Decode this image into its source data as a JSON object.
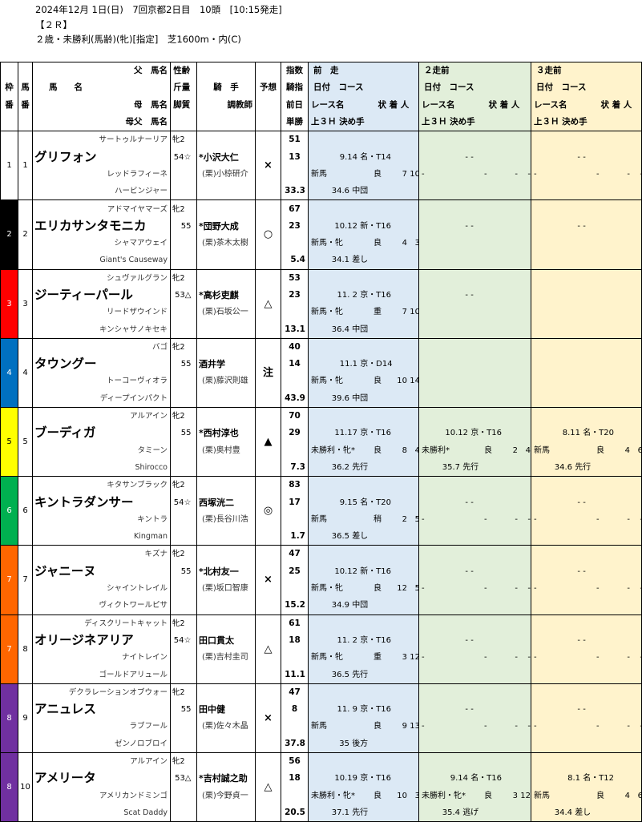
{
  "race": {
    "line1": "2024年12月 1日(日)　7回京都2日目　10頭　[10:15発走]",
    "line2": "【２Ｒ】",
    "line3": "２歳・未勝利(馬齢)(牝)[指定]　芝1600m・内(C)"
  },
  "headers": {
    "waku": [
      "枠",
      "番"
    ],
    "uma": [
      "馬",
      "番"
    ],
    "name": [
      "父　馬名",
      "馬　　名",
      "母　馬名",
      "母父　馬名"
    ],
    "sex": [
      "性齢",
      "斤量",
      "脚質"
    ],
    "jockey": [
      "騎　手",
      "調教師"
    ],
    "pred": "予想",
    "idx": [
      "指数",
      "騎指",
      "前日",
      "単勝"
    ],
    "prev1": [
      "前　走",
      "日付　コース",
      "レース名　　　　状 着 人",
      "上３Ｈ 決め手"
    ],
    "prev2": [
      "２走前",
      "日付　コース",
      "レース名　　　　状 着 人",
      "上３Ｈ 決め手"
    ],
    "prev3": [
      "３走前",
      "日付　コース",
      "レース名　　　　状 着 人",
      "上３Ｈ 決め手"
    ]
  },
  "horses": [
    {
      "waku": "1",
      "num": "1",
      "sire": "サートゥルナーリア",
      "name": "グリフォン",
      "dam": "レッドラフィーネ",
      "damsire": "ハービンジャー",
      "sex": "牝2",
      "weight": "54☆",
      "jockey": "*小沢大仁",
      "trainer": "(栗)小椋研介",
      "pred": "×",
      "idx": "51",
      "jidx": "13",
      "odds": "33.3",
      "p1": {
        "date": "9.14",
        "course": "名・T14",
        "race": "新馬",
        "cond": "良",
        "pos": "7",
        "pop": "10",
        "l3": "34.6",
        "style": "中団"
      },
      "p2": {
        "date": "-",
        "course": "-",
        "race": "-",
        "cond": "-",
        "pos": "-",
        "pop": "-",
        "l3": "",
        "style": ""
      },
      "p3": {
        "date": "-",
        "course": "-",
        "race": "-",
        "cond": "-",
        "pos": "-",
        "pop": "-",
        "l3": "",
        "style": ""
      }
    },
    {
      "waku": "2",
      "num": "2",
      "sire": "アドマイヤマーズ",
      "name": "エリカサンタモニカ",
      "dam": "シャマアウェイ",
      "damsire": "Giant's Causeway",
      "sex": "牝2",
      "weight": "55",
      "jockey": "*団野大成",
      "trainer": "(栗)茶木太樹",
      "pred": "○",
      "idx": "67",
      "jidx": "23",
      "odds": "5.4",
      "p1": {
        "date": "10.12",
        "course": "新・T16",
        "race": "新馬・牝",
        "cond": "良",
        "pos": "4",
        "pop": "3",
        "l3": "34.1",
        "style": "差し"
      },
      "p2": {
        "date": "-",
        "course": "-",
        "race": "",
        "cond": "",
        "pos": "",
        "pop": "",
        "l3": "",
        "style": ""
      },
      "p3": {
        "date": "-",
        "course": "-",
        "race": "",
        "cond": "",
        "pos": "",
        "pop": "",
        "l3": "",
        "style": ""
      }
    },
    {
      "waku": "3",
      "num": "3",
      "sire": "シュヴァルグラン",
      "name": "ジーティーパール",
      "dam": "リードザウインド",
      "damsire": "キンシャサノキセキ",
      "sex": "牝2",
      "weight": "53△",
      "jockey": "*高杉吏麒",
      "trainer": "(栗)石坂公一",
      "pred": "△",
      "idx": "53",
      "jidx": "23",
      "odds": "13.1",
      "p1": {
        "date": "11. 2",
        "course": "京・T16",
        "race": "新馬・牝",
        "cond": "重",
        "pos": "7",
        "pop": "10",
        "l3": "36.4",
        "style": "中団"
      },
      "p2": {
        "date": "-",
        "course": "-",
        "race": "",
        "cond": "",
        "pos": "",
        "pop": "",
        "l3": "",
        "style": ""
      },
      "p3": {
        "date": "",
        "course": "",
        "race": "",
        "cond": "",
        "pos": "",
        "pop": "",
        "l3": "",
        "style": ""
      }
    },
    {
      "waku": "4",
      "num": "4",
      "sire": "バゴ",
      "name": "タウングー",
      "dam": "トーコーヴィオラ",
      "damsire": "ディープインパクト",
      "sex": "牝2",
      "weight": "55",
      "jockey": "酒井学",
      "trainer": "(栗)藤沢則雄",
      "pred": "注",
      "idx": "40",
      "jidx": "14",
      "odds": "43.9",
      "p1": {
        "date": "11.1",
        "course": "京・D14",
        "race": "新馬・牝",
        "cond": "良",
        "pos": "10",
        "pop": "14",
        "l3": "39.6",
        "style": "中団"
      },
      "p2": {
        "date": "",
        "course": "",
        "race": "",
        "cond": "",
        "pos": "",
        "pop": "",
        "l3": "",
        "style": ""
      },
      "p3": {
        "date": "",
        "course": "",
        "race": "",
        "cond": "",
        "pos": "",
        "pop": "",
        "l3": "",
        "style": ""
      }
    },
    {
      "waku": "5",
      "num": "5",
      "sire": "アルアイン",
      "name": "ブーディガ",
      "dam": "タミーン",
      "damsire": "Shirocco",
      "sex": "牝2",
      "weight": "55",
      "jockey": "*西村淳也",
      "trainer": "(栗)奥村豊",
      "pred": "▲",
      "idx": "70",
      "jidx": "29",
      "odds": "7.3",
      "p1": {
        "date": "11.17",
        "course": "京・T16",
        "race": "未勝利・牝*",
        "cond": "良",
        "pos": "8",
        "pop": "4",
        "l3": "36.2",
        "style": "先行"
      },
      "p2": {
        "date": "10.12",
        "course": "京・T16",
        "race": "未勝利*",
        "cond": "良",
        "pos": "2",
        "pop": "4",
        "l3": "35.7",
        "style": "先行"
      },
      "p3": {
        "date": "8.11",
        "course": "名・T20",
        "race": "新馬",
        "cond": "良",
        "pos": "4",
        "pop": "6",
        "l3": "34.6",
        "style": "先行"
      }
    },
    {
      "waku": "6",
      "num": "6",
      "sire": "キタサンブラック",
      "name": "キントラダンサー",
      "dam": "キントラ",
      "damsire": "Kingman",
      "sex": "牝2",
      "weight": "54☆",
      "jockey": "西塚洸二",
      "trainer": "(栗)長谷川浩",
      "pred": "◎",
      "idx": "83",
      "jidx": "17",
      "odds": "1.7",
      "p1": {
        "date": "9.15",
        "course": "名・T20",
        "race": "新馬",
        "cond": "稍",
        "pos": "2",
        "pop": "5",
        "l3": "36.5",
        "style": "差し"
      },
      "p2": {
        "date": "-",
        "course": "-",
        "race": "-",
        "cond": "-",
        "pos": "-",
        "pop": "-",
        "l3": "",
        "style": ""
      },
      "p3": {
        "date": "-",
        "course": "-",
        "race": "-",
        "cond": "-",
        "pos": "-",
        "pop": "-",
        "l3": "",
        "style": ""
      }
    },
    {
      "waku": "7",
      "num": "7",
      "sire": "キズナ",
      "name": "ジャニーヌ",
      "dam": "シャイントレイル",
      "damsire": "ヴィクトワールピサ",
      "sex": "牝2",
      "weight": "55",
      "jockey": "*北村友一",
      "trainer": "(栗)坂口智康",
      "pred": "×",
      "idx": "47",
      "jidx": "25",
      "odds": "15.2",
      "p1": {
        "date": "10.12",
        "course": "新・T16",
        "race": "新馬・牝",
        "cond": "良",
        "pos": "12",
        "pop": "5",
        "l3": "34.9",
        "style": "中団"
      },
      "p2": {
        "date": "-",
        "course": "-",
        "race": "-",
        "cond": "-",
        "pos": "-",
        "pop": "-",
        "l3": "",
        "style": ""
      },
      "p3": {
        "date": "-",
        "course": "-",
        "race": "-",
        "cond": "-",
        "pos": "-",
        "pop": "-",
        "l3": "",
        "style": ""
      }
    },
    {
      "waku": "7",
      "num": "8",
      "sire": "ディスクリートキャット",
      "name": "オリージネアリア",
      "dam": "ナイトレイン",
      "damsire": "ゴールドアリュール",
      "sex": "牝2",
      "weight": "54☆",
      "jockey": "田口貫太",
      "trainer": "(栗)吉村圭司",
      "pred": "△",
      "idx": "61",
      "jidx": "18",
      "odds": "11.1",
      "p1": {
        "date": "11. 2",
        "course": "京・T16",
        "race": "新馬・牝",
        "cond": "重",
        "pos": "3",
        "pop": "12",
        "l3": "36.5",
        "style": "先行"
      },
      "p2": {
        "date": "-",
        "course": "-",
        "race": "-",
        "cond": "-",
        "pos": "-",
        "pop": "-",
        "l3": "",
        "style": ""
      },
      "p3": {
        "date": "-",
        "course": "-",
        "race": "-",
        "cond": "-",
        "pos": "-",
        "pop": "-",
        "l3": "",
        "style": ""
      }
    },
    {
      "waku": "8",
      "num": "9",
      "sire": "デクラレーションオブウォー",
      "name": "アニュレス",
      "dam": "ラブフール",
      "damsire": "ゼンノロブロイ",
      "sex": "牝2",
      "weight": "55",
      "jockey": "田中健",
      "trainer": "(栗)佐々木晶",
      "pred": "×",
      "idx": "47",
      "jidx": "8",
      "odds": "37.8",
      "p1": {
        "date": "11. 9",
        "course": "京・T16",
        "race": "新馬",
        "cond": "良",
        "pos": "9",
        "pop": "13",
        "l3": "35",
        "style": "後方"
      },
      "p2": {
        "date": "-",
        "course": "-",
        "race": "-",
        "cond": "-",
        "pos": "-",
        "pop": "-",
        "l3": "",
        "style": ""
      },
      "p3": {
        "date": "-",
        "course": "-",
        "race": "-",
        "cond": "-",
        "pos": "-",
        "pop": "-",
        "l3": "",
        "style": ""
      }
    },
    {
      "waku": "8",
      "num": "10",
      "sire": "アルアイン",
      "name": "アメリータ",
      "dam": "アメリカンドミンゴ",
      "damsire": "Scat Daddy",
      "sex": "牝2",
      "weight": "53△",
      "jockey": "*吉村誠之助",
      "trainer": "(栗)今野貞一",
      "pred": "△",
      "idx": "56",
      "jidx": "18",
      "odds": "20.5",
      "p1": {
        "date": "10.19",
        "course": "京・T16",
        "race": "未勝利・牝*",
        "cond": "良",
        "pos": "10",
        "pop": "3",
        "l3": "37.1",
        "style": "先行"
      },
      "p2": {
        "date": "9.14",
        "course": "名・T16",
        "race": "未勝利・牝*",
        "cond": "良",
        "pos": "3",
        "pop": "12",
        "l3": "35.4",
        "style": "逃げ"
      },
      "p3": {
        "date": "8.1",
        "course": "名・T12",
        "race": "新馬",
        "cond": "良",
        "pos": "4",
        "pop": "6",
        "l3": "34.4",
        "style": "差し"
      }
    }
  ],
  "colors": {
    "waku": {
      "1": "#ffffff",
      "2": "#000000",
      "3": "#ff0000",
      "4": "#0070c0",
      "5": "#ffff00",
      "6": "#00b050",
      "7": "#ff6600",
      "8": "#7030a0"
    },
    "waku_text": {
      "1": "#000000",
      "2": "#ffffff",
      "3": "#ffffff",
      "4": "#ffffff",
      "5": "#000000",
      "6": "#ffffff",
      "7": "#ffffff",
      "8": "#ffffff"
    },
    "prev1_bg": "#dce9f5",
    "prev2_bg": "#e2efda",
    "prev3_bg": "#fff3cc"
  }
}
